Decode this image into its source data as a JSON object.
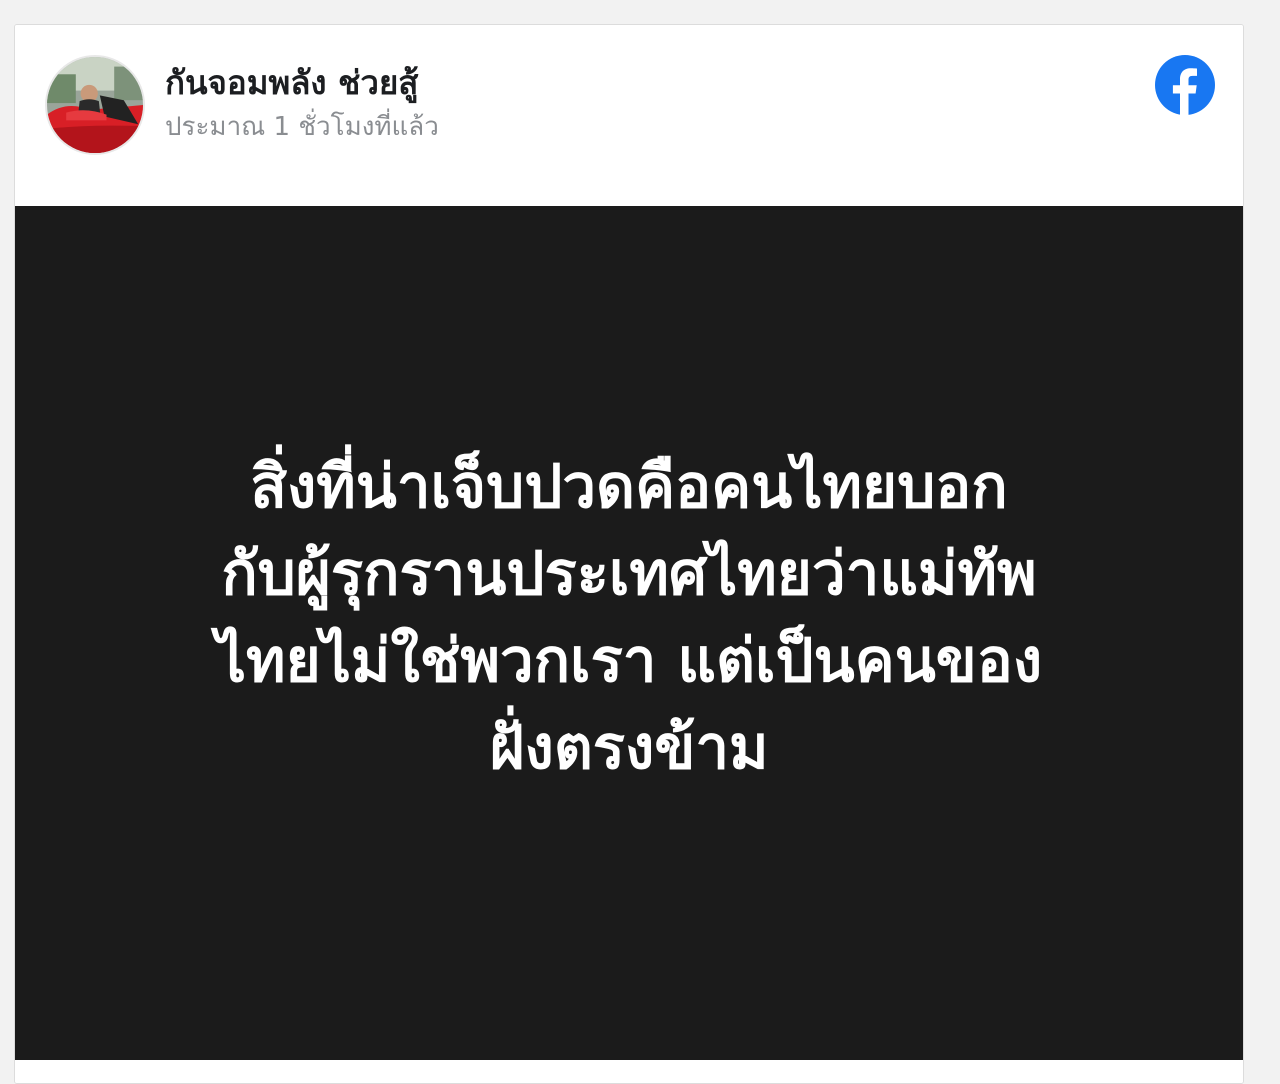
{
  "post": {
    "author": {
      "name": "กันจอมพลัง ช่วยสู้",
      "avatar": "profile-photo-man-in-red-car"
    },
    "timestamp": "ประมาณ 1 ชั่วโมงที่แล้ว",
    "platform_icon": "facebook-logo-icon",
    "image": {
      "background_color": "#1b1b1b",
      "text_color": "#ffffff",
      "lines": [
        "สิ่งที่น่าเจ็บปวดคือคนไทยบอก",
        "กับผู้รุกรานประเทศไทยว่าแม่ทัพ",
        "ไทยไม่ใช่พวกเรา แต่เป็นคนของ",
        "ฝั่งตรงข้าม"
      ]
    }
  },
  "colors": {
    "facebook_blue": "#1877f2",
    "timestamp_gray": "#8a8d91",
    "name_color": "#1c1e21"
  }
}
